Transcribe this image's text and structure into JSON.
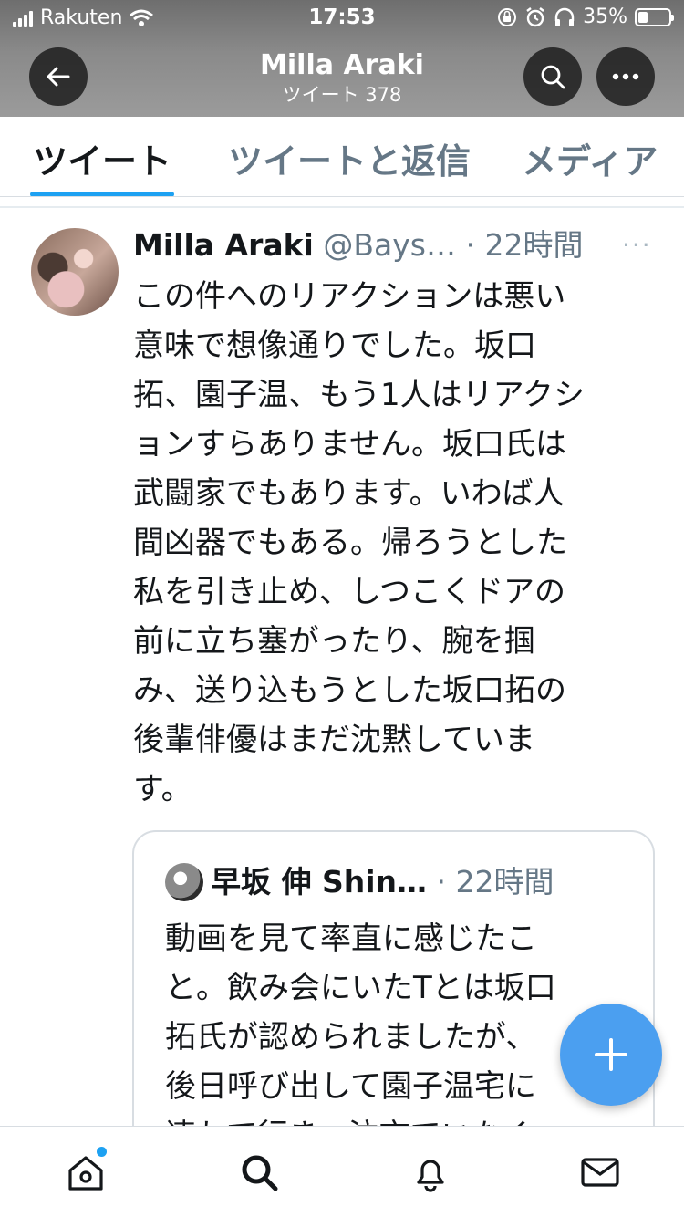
{
  "status_bar": {
    "carrier": "Rakuten",
    "time": "17:53",
    "battery": "35%"
  },
  "header": {
    "name": "Milla Araki",
    "tweet_count": "ツイート 378"
  },
  "tabs": [
    {
      "label": "ツイート",
      "active": true
    },
    {
      "label": "ツイートと返信",
      "active": false
    },
    {
      "label": "メディア",
      "active": false
    }
  ],
  "tweet": {
    "display_name": "Milla Araki",
    "handle": "@Bays…",
    "separator": "·",
    "time": "22時間",
    "more": "···",
    "text_lines": [
      "この件へのリアクションは悪い",
      "意味で想像通りでした。坂口",
      "拓、園子温、もう1人はリアクシ",
      "ョンすらありません。坂口氏は",
      "武闘家でもあります。いわば人",
      "間凶器でもある。帰ろうとした",
      "私を引き止め、しつこくドアの",
      "前に立ち塞がったり、腕を掴",
      "み、送り込もうとした坂口拓の",
      "後輩俳優はまだ沈黙していま",
      "す。"
    ]
  },
  "quote": {
    "display_name": "早坂 伸 Shin…",
    "separator": "·",
    "time": "22時間",
    "text_lines": [
      "動画を見て率直に感じたこ",
      "と。飲み会にいたTとは坂口",
      "拓氏が認められましたが、",
      "後日呼び出して園子温宅に",
      "連れて行き、泣市ていなく"
    ]
  },
  "icons": {
    "back": "arrow-left-icon",
    "search": "search-icon",
    "more": "more-icon",
    "compose": "plus-icon",
    "home": "home-icon",
    "explore": "search-icon",
    "notifications": "bell-icon",
    "messages": "mail-icon"
  },
  "colors": {
    "accent": "#1da1f2",
    "fab": "#4b9ff0",
    "secondary_text": "#657786"
  }
}
